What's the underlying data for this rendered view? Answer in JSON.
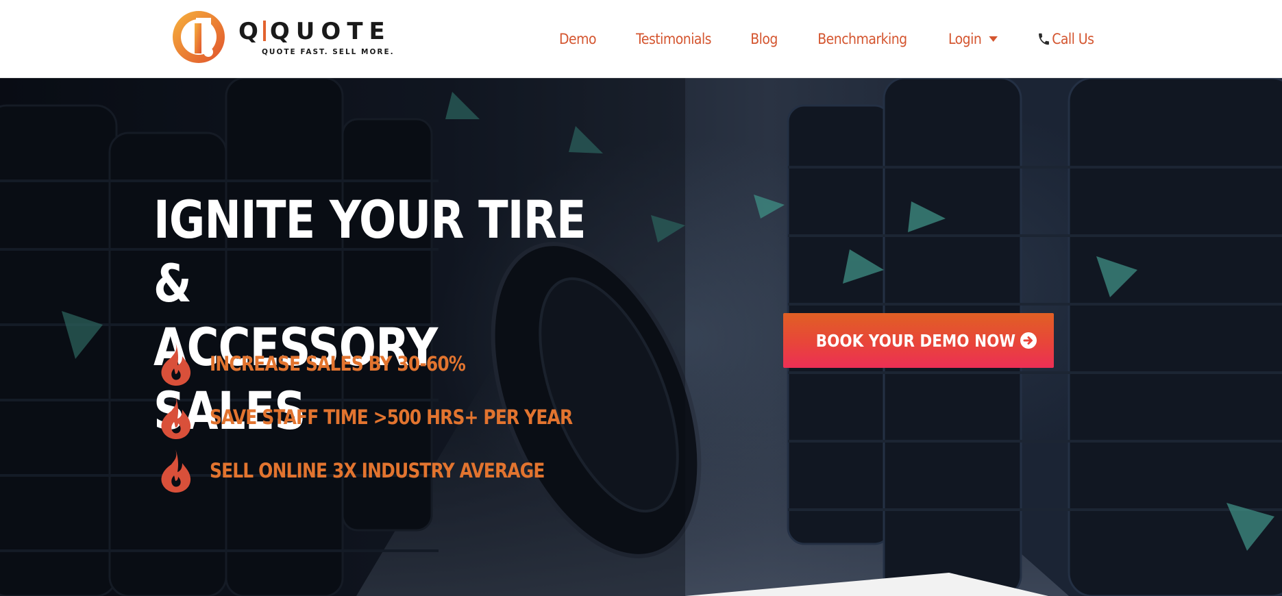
{
  "brand": {
    "name_left": "Q",
    "name_right": "QUOTE",
    "tagline": "QUOTE FAST. SELL MORE.",
    "colors": {
      "orange": "#e2622e",
      "orange_light": "#f4a73c",
      "nav_text": "#d4552f"
    }
  },
  "nav": {
    "items": [
      {
        "label": "Demo"
      },
      {
        "label": "Testimonials"
      },
      {
        "label": "Blog"
      },
      {
        "label": "Benchmarking"
      },
      {
        "label": "Login",
        "icon": "chevron-down-icon"
      },
      {
        "label": "Call Us",
        "icon": "phone-icon"
      }
    ]
  },
  "hero": {
    "title_line1": "IGNITE YOUR TIRE &",
    "title_line2": "ACCESSORY SALES",
    "benefits": [
      {
        "icon": "flame-icon",
        "text": "INCREASE SALES BY 30-60%"
      },
      {
        "icon": "flame-icon",
        "text": "SAVE STAFF TIME >500 HRS+ PER YEAR"
      },
      {
        "icon": "flame-icon",
        "text": "SELL ONLINE 3X INDUSTRY AVERAGE"
      }
    ],
    "cta_label": "BOOK YOUR DEMO NOW",
    "cta_icon": "arrow-circle-right-icon",
    "colors": {
      "benefit_text": "#e2742f",
      "cta_top": "#e06024",
      "cta_bottom": "#ec2f55"
    }
  }
}
